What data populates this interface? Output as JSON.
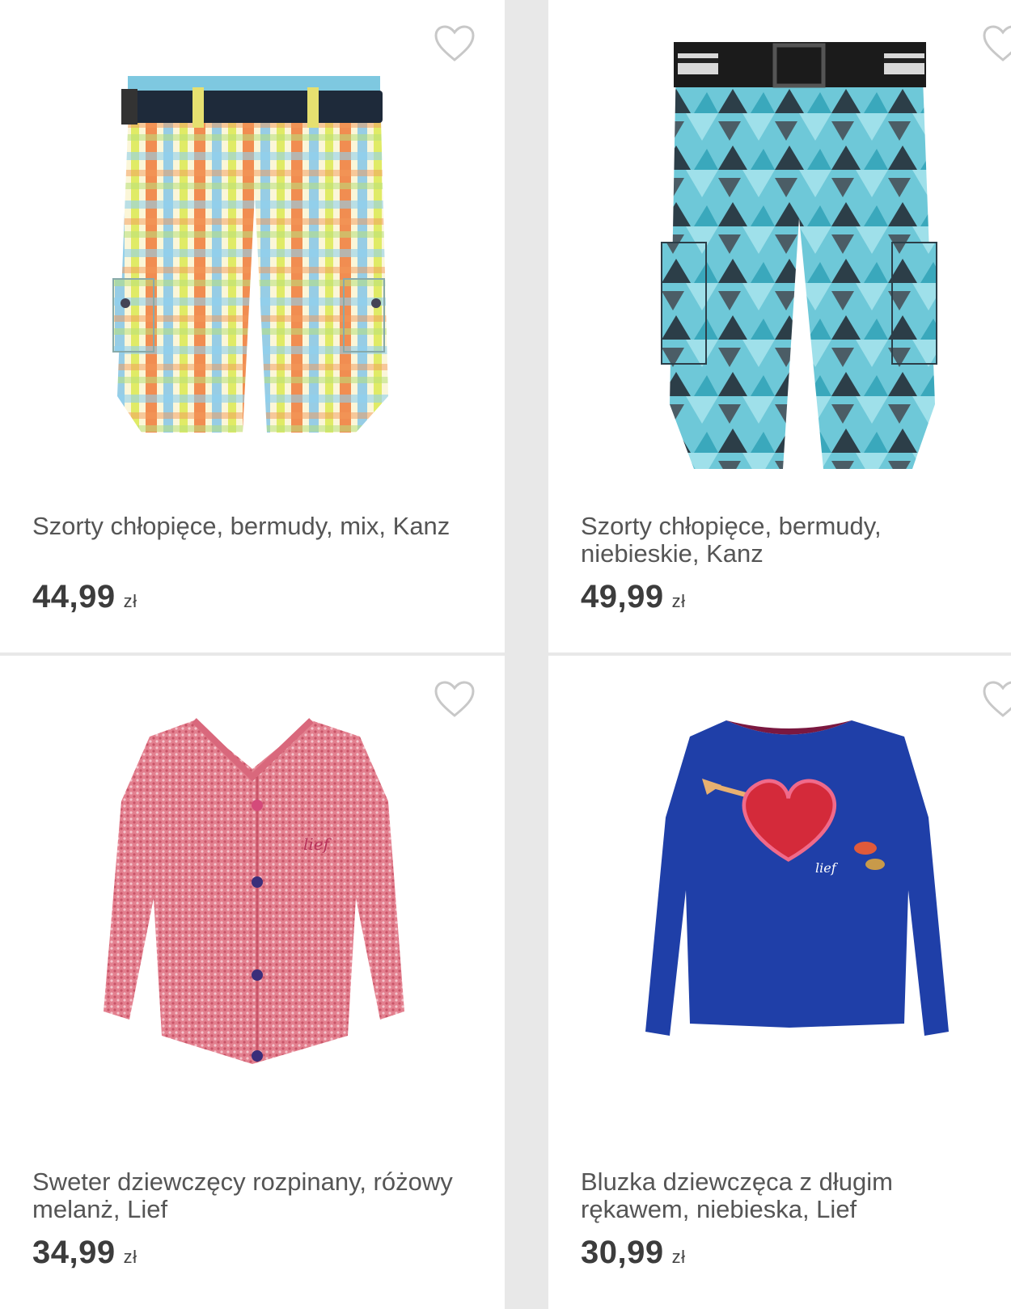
{
  "products": [
    {
      "title": "Szorty chłopięce, bermudy, mix, Kanz",
      "price": "44,99",
      "currency": "zł",
      "image_icon": "plaid-shorts-image"
    },
    {
      "title": "Szorty chłopięce, bermudy, niebieskie, Kanz",
      "price": "49,99",
      "currency": "zł",
      "image_icon": "blue-shorts-image"
    },
    {
      "title": "Sweter dziewczęcy rozpinany, różowy melanż, Lief",
      "price": "34,99",
      "currency": "zł",
      "image_icon": "pink-sweater-image"
    },
    {
      "title": "Bluzka dziewczęca z długim rękawem, niebieska, Lief",
      "price": "30,99",
      "currency": "zł",
      "image_icon": "blue-blouse-image"
    }
  ],
  "colors": {
    "background": "#e8e8e8",
    "card": "#ffffff",
    "text": "#555555",
    "price": "#3c3c3c"
  }
}
